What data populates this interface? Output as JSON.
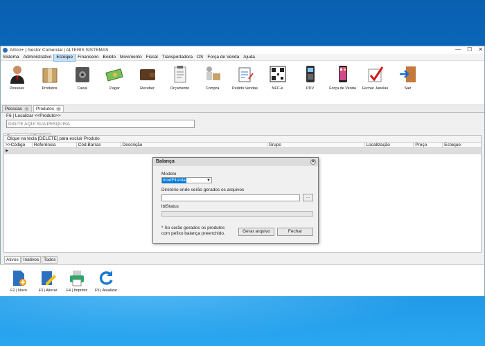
{
  "window": {
    "title": "Artico+ | Gestor Comercial | ALTERIS SISTEMAS",
    "min": "—",
    "max": "☐",
    "close": "✕"
  },
  "menu": [
    "Sistema",
    "Administrativo",
    "Estoque",
    "Financeiro",
    "Boleto",
    "Movimento",
    "Fiscal",
    "Transportadora",
    "OS",
    "Força de Venda",
    "Ajuda"
  ],
  "toolbar": {
    "pessoas": "Pessoas",
    "produtos": "Produtos",
    "caixa": "Caixa",
    "pagar": "Pagar",
    "receber": "Receber",
    "orcamento": "Orçamento",
    "compra": "Compra",
    "pedido": "Pedido Vendas",
    "nfce": "NFC-e",
    "pdv": "PDV",
    "forca": "Força de Venda",
    "fechar": "Fechar Janelas",
    "sair": "Sair"
  },
  "doc_tabs": {
    "pessoas": "Pessoas",
    "produtos": "Produtos",
    "close": "×"
  },
  "locate": {
    "label": "F6 | Localizar <<Produto>>",
    "placeholder": "DIGITE AQUI SUA PESQUISA"
  },
  "sub_tabs": {
    "produtos": "Produtos",
    "seriais": "Seriais"
  },
  "grid": {
    "hint": "Clique na tecla [DELETE] para excluir Produto",
    "row_marker": "▶",
    "columns": [
      ">>Código",
      "Referência",
      "Cód.Barras",
      "Descrição",
      "Grupo",
      "Localização",
      "Preço",
      "Estoque"
    ]
  },
  "bottom_tabs": {
    "ativos": "Ativos",
    "inativos": "Inativos",
    "todos": "Todos"
  },
  "actions": {
    "novo": "F2 | Novo",
    "alterar": "F3 | Alterar",
    "imprimir": "F4 | Imprimir",
    "atualizar": "F5 | Atualizar"
  },
  "dialog": {
    "title": "Balança",
    "close": "✕",
    "modelo_label": "Modelo",
    "modelo_value": "modFilizola",
    "dir_label": "Diretório onde serão gerados os arquivos",
    "dots": "...",
    "status_label": "lblStatus",
    "note": "* So serão gerados os produtos com pefixo balança preenchido.",
    "gerar": "Gerar arquivo",
    "fechar": "Fechar"
  }
}
